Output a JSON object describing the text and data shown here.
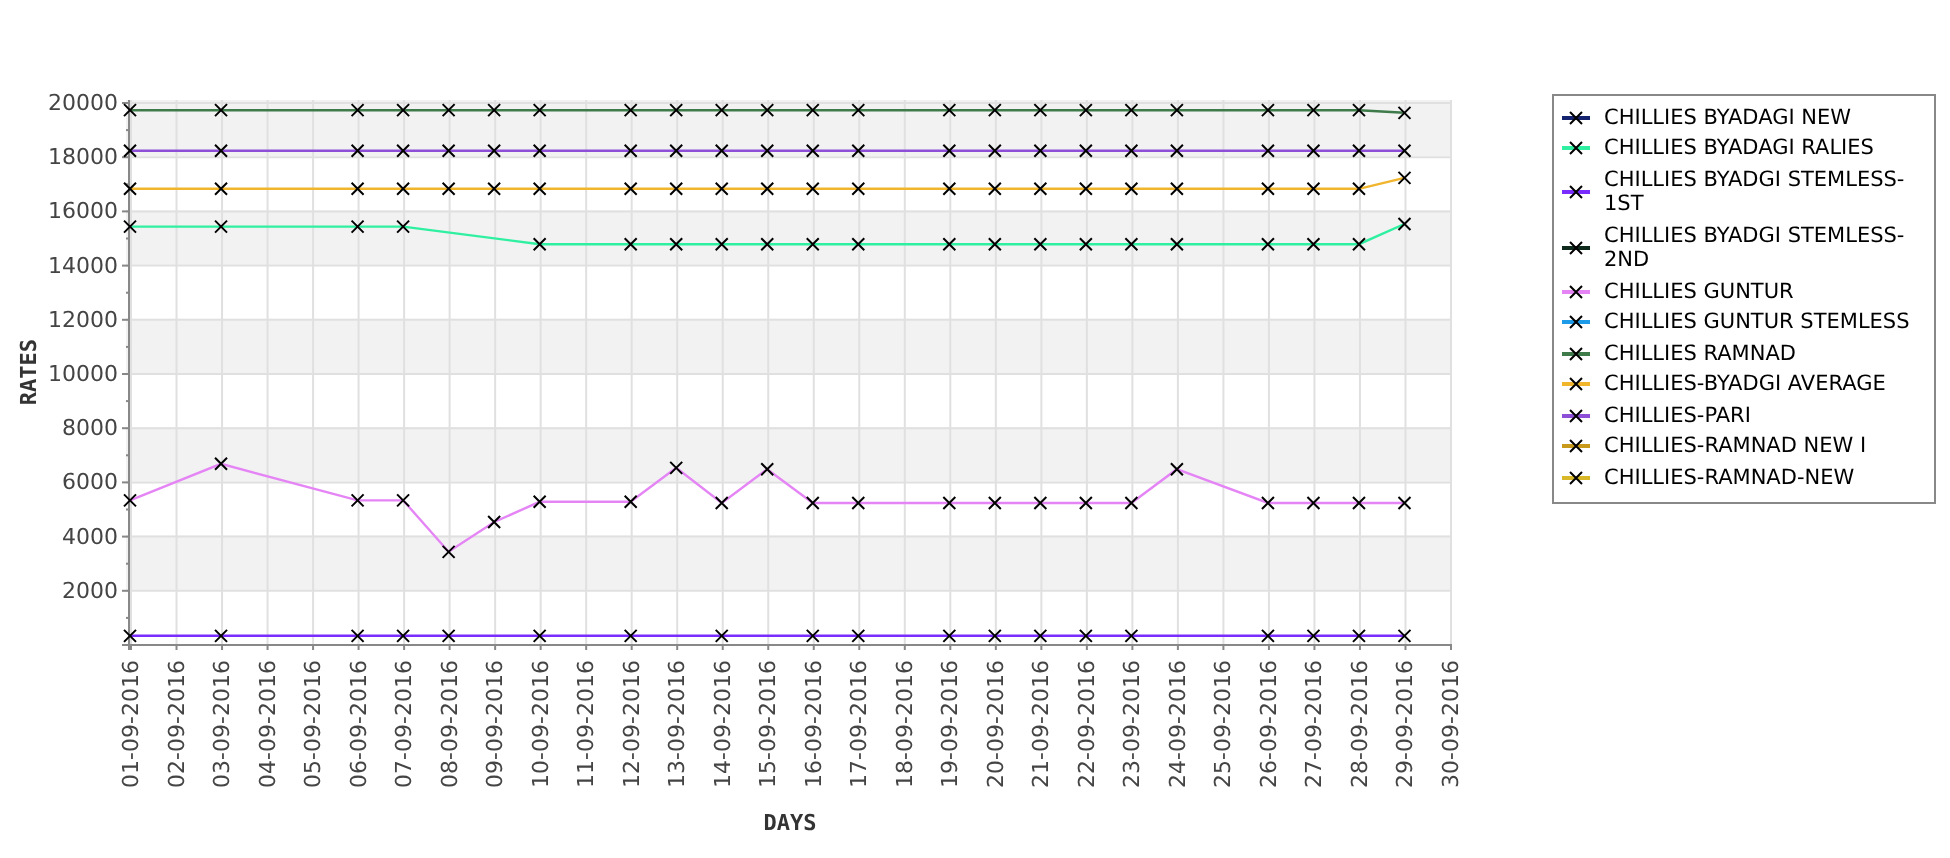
{
  "chart_data": {
    "type": "line",
    "xlabel": "DAYS",
    "ylabel": "RATES",
    "categories": [
      "01-09-2016",
      "02-09-2016",
      "03-09-2016",
      "04-09-2016",
      "05-09-2016",
      "06-09-2016",
      "07-09-2016",
      "08-09-2016",
      "09-09-2016",
      "10-09-2016",
      "11-09-2016",
      "12-09-2016",
      "13-09-2016",
      "14-09-2016",
      "15-09-2016",
      "16-09-2016",
      "17-09-2016",
      "18-09-2016",
      "19-09-2016",
      "20-09-2016",
      "21-09-2016",
      "22-09-2016",
      "23-09-2016",
      "24-09-2016",
      "25-09-2016",
      "26-09-2016",
      "27-09-2016",
      "28-09-2016",
      "29-09-2016",
      "30-09-2016"
    ],
    "ylim": [
      0,
      20000
    ],
    "grid": true,
    "yticks": [
      2000,
      4000,
      6000,
      8000,
      10000,
      12000,
      14000,
      16000,
      18000,
      20000
    ],
    "series": [
      {
        "name": "CHILLIES BYADAGI NEW",
        "color": "#15236e",
        "values": [
          null,
          null,
          null,
          null,
          null,
          null,
          null,
          null,
          null,
          null,
          null,
          null,
          null,
          null,
          null,
          null,
          null,
          null,
          null,
          null,
          null,
          null,
          null,
          null,
          null,
          null,
          null,
          null,
          null,
          null
        ]
      },
      {
        "name": "CHILLIES BYADAGI RALIES",
        "color": "#2ef0a0",
        "marker": "x",
        "values": [
          15400,
          null,
          15400,
          null,
          null,
          15400,
          15400,
          null,
          null,
          14750,
          null,
          14750,
          14750,
          14750,
          14750,
          14750,
          14750,
          null,
          14750,
          14750,
          14750,
          14750,
          14750,
          14750,
          null,
          14750,
          14750,
          14750,
          15500,
          null
        ]
      },
      {
        "name": "CHILLIES BYADGI STEMLESS-1ST",
        "color": "#7a2cff",
        "marker": "x",
        "values": [
          300,
          null,
          300,
          null,
          null,
          300,
          300,
          300,
          null,
          300,
          null,
          300,
          null,
          300,
          null,
          300,
          300,
          null,
          300,
          300,
          300,
          300,
          300,
          null,
          null,
          300,
          300,
          300,
          300,
          null
        ]
      },
      {
        "name": "CHILLIES BYADGI STEMLESS-2ND",
        "color": "#0e2a1c",
        "values": [
          null,
          null,
          null,
          null,
          null,
          null,
          null,
          null,
          null,
          null,
          null,
          null,
          null,
          null,
          null,
          null,
          null,
          null,
          null,
          null,
          null,
          null,
          null,
          null,
          null,
          null,
          null,
          null,
          null,
          null
        ]
      },
      {
        "name": "CHILLIES GUNTUR",
        "color": "#e585f5",
        "marker": "x",
        "values": [
          5300,
          null,
          6650,
          null,
          null,
          5300,
          5300,
          3400,
          4500,
          5250,
          null,
          5250,
          6500,
          5200,
          6450,
          5200,
          5200,
          null,
          5200,
          5200,
          5200,
          5200,
          5200,
          6450,
          null,
          5200,
          5200,
          5200,
          5200,
          null
        ]
      },
      {
        "name": "CHILLIES GUNTUR STEMLESS",
        "color": "#1e9be8",
        "values": [
          null,
          null,
          null,
          null,
          null,
          null,
          null,
          null,
          null,
          null,
          null,
          null,
          null,
          null,
          null,
          null,
          null,
          null,
          null,
          null,
          null,
          null,
          null,
          null,
          null,
          null,
          null,
          null,
          null,
          null
        ]
      },
      {
        "name": "CHILLIES RAMNAD",
        "color": "#3e7a4a",
        "marker": "x",
        "values": [
          19700,
          null,
          19700,
          null,
          null,
          19700,
          19700,
          19700,
          19700,
          19700,
          null,
          19700,
          19700,
          19700,
          19700,
          19700,
          19700,
          null,
          19700,
          19700,
          19700,
          19700,
          19700,
          19700,
          null,
          19700,
          19700,
          19700,
          19600,
          null
        ]
      },
      {
        "name": "CHILLIES-BYADGI AVERAGE",
        "color": "#f0b52c",
        "marker": "x",
        "values": [
          16800,
          null,
          16800,
          null,
          null,
          16800,
          16800,
          16800,
          16800,
          16800,
          null,
          16800,
          16800,
          16800,
          16800,
          16800,
          16800,
          null,
          16800,
          16800,
          16800,
          16800,
          16800,
          16800,
          null,
          16800,
          16800,
          16800,
          17200,
          null
        ]
      },
      {
        "name": "CHILLIES-PARI",
        "color": "#8c4fd6",
        "marker": "x",
        "values": [
          18200,
          null,
          18200,
          null,
          null,
          18200,
          18200,
          18200,
          18200,
          18200,
          null,
          18200,
          18200,
          18200,
          18200,
          18200,
          18200,
          null,
          18200,
          18200,
          18200,
          18200,
          18200,
          18200,
          null,
          18200,
          18200,
          18200,
          18200,
          null
        ]
      },
      {
        "name": "CHILLIES-RAMNAD NEW I",
        "color": "#c89a1c",
        "values": [
          null,
          null,
          null,
          null,
          null,
          null,
          null,
          null,
          null,
          null,
          null,
          null,
          null,
          null,
          null,
          null,
          null,
          null,
          null,
          null,
          null,
          null,
          null,
          null,
          null,
          null,
          null,
          null,
          null,
          null
        ]
      },
      {
        "name": "CHILLIES-RAMNAD-NEW",
        "color": "#d8b828",
        "values": [
          null,
          null,
          null,
          null,
          null,
          null,
          null,
          null,
          null,
          null,
          null,
          null,
          null,
          null,
          null,
          null,
          null,
          null,
          null,
          null,
          null,
          null,
          null,
          null,
          null,
          null,
          null,
          null,
          null,
          null
        ]
      }
    ]
  }
}
